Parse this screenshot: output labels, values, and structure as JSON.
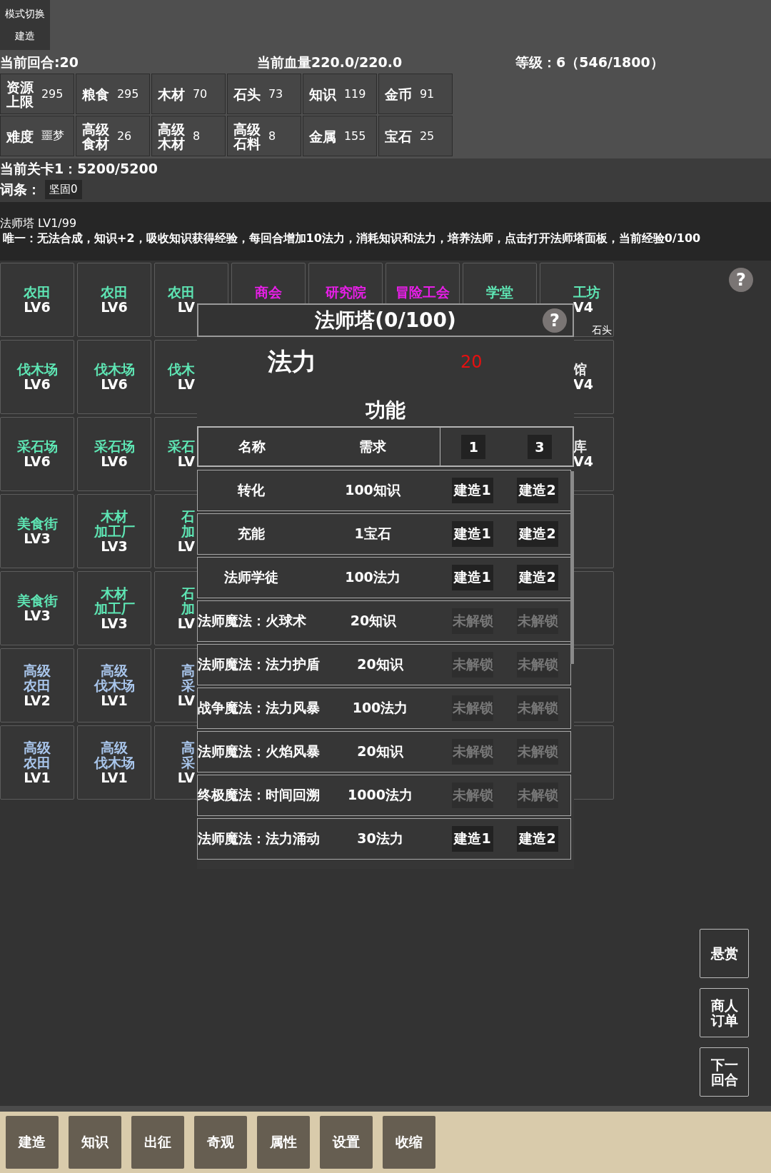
{
  "mode_switch": {
    "label": "模式切换",
    "value": "建造"
  },
  "stats": {
    "round": "当前回合:20",
    "hp": "当前血量220.0/220.0",
    "level": "等级：6（546/1800）"
  },
  "resources": [
    {
      "label": "资源上限",
      "value": "295"
    },
    {
      "label": "粮食",
      "value": "295"
    },
    {
      "label": "木材",
      "value": "70"
    },
    {
      "label": "石头",
      "value": "73"
    },
    {
      "label": "知识",
      "value": "119"
    },
    {
      "label": "金币",
      "value": "91"
    },
    {
      "label": "难度",
      "value": "噩梦"
    },
    {
      "label": "高级食材",
      "value": "26"
    },
    {
      "label": "高级木材",
      "value": "8"
    },
    {
      "label": "高级石料",
      "value": "8"
    },
    {
      "label": "金属",
      "value": "155"
    },
    {
      "label": "宝石",
      "value": "25"
    }
  ],
  "stage": {
    "progress": "当前关卡1：5200/5200",
    "affix_label": "词条：",
    "affixes": [
      "坚固0"
    ]
  },
  "selected_building": {
    "title": "法师塔 LV1/99",
    "description": "唯一：无法合成，知识+2，吸收知识获得经验，每回合增加10法力，消耗知识和法力，培养法师，点击打开法师塔面板，当前经验0/100"
  },
  "help_icon": "?",
  "grid": [
    [
      {
        "kind": "building",
        "name_lines": [
          "农田"
        ],
        "level": "LV6",
        "color": "#5ee6b4"
      },
      {
        "kind": "building",
        "name_lines": [
          "农田"
        ],
        "level": "LV6",
        "color": "#5ee6b4"
      },
      {
        "kind": "building",
        "name_lines": [
          "农田"
        ],
        "level": "LV",
        "color": "#5ee6b4"
      },
      {
        "kind": "building",
        "name_lines": [
          "商会"
        ],
        "color": "#e81ee8"
      },
      {
        "kind": "building",
        "name_lines": [
          "研究院"
        ],
        "color": "#e81ee8"
      },
      {
        "kind": "building",
        "name_lines": [
          "冒险工会"
        ],
        "color": "#e81ee8"
      },
      {
        "kind": "building",
        "name_lines": [
          "学堂"
        ],
        "color": "#5ee6b4"
      },
      {
        "kind": "building",
        "name_lines": [
          "工坊"
        ],
        "level": "V4",
        "color": "#5ee6b4",
        "badge": "石头"
      }
    ],
    [
      {
        "kind": "building",
        "name_lines": [
          "伐木场"
        ],
        "level": "LV6",
        "color": "#5ee6b4"
      },
      {
        "kind": "building",
        "name_lines": [
          "伐木场"
        ],
        "level": "LV6",
        "color": "#5ee6b4"
      },
      {
        "kind": "building",
        "name_lines": [
          "伐木"
        ],
        "level": "LV",
        "color": "#5ee6b4"
      },
      {
        "kind": "covered"
      },
      {
        "kind": "covered"
      },
      {
        "kind": "covered"
      },
      {
        "kind": "covered"
      },
      {
        "kind": "building",
        "name_lines": [
          "馆"
        ],
        "level": "V4",
        "color": "#eeeeee"
      }
    ],
    [
      {
        "kind": "building",
        "name_lines": [
          "采石场"
        ],
        "level": "LV6",
        "color": "#5ee6b4"
      },
      {
        "kind": "building",
        "name_lines": [
          "采石场"
        ],
        "level": "LV6",
        "color": "#5ee6b4"
      },
      {
        "kind": "building",
        "name_lines": [
          "采石"
        ],
        "level": "LV",
        "color": "#5ee6b4"
      },
      {
        "kind": "covered"
      },
      {
        "kind": "covered"
      },
      {
        "kind": "covered"
      },
      {
        "kind": "covered"
      },
      {
        "kind": "building",
        "name_lines": [
          "库"
        ],
        "level": "V4",
        "color": "#eeeeee"
      }
    ],
    [
      {
        "kind": "building",
        "name_lines": [
          "美食街"
        ],
        "level": "LV3",
        "color": "#5ee6b4"
      },
      {
        "kind": "building",
        "name_lines": [
          "木材",
          "加工厂"
        ],
        "level": "LV3",
        "color": "#5ee6b4"
      },
      {
        "kind": "building",
        "name_lines": [
          "石",
          "加"
        ],
        "level": "LV",
        "color": "#5ee6b4"
      },
      {
        "kind": "covered"
      },
      {
        "kind": "covered"
      },
      {
        "kind": "covered"
      },
      {
        "kind": "covered"
      },
      {
        "kind": "empty"
      }
    ],
    [
      {
        "kind": "building",
        "name_lines": [
          "美食街"
        ],
        "level": "LV3",
        "color": "#5ee6b4"
      },
      {
        "kind": "building",
        "name_lines": [
          "木材",
          "加工厂"
        ],
        "level": "LV3",
        "color": "#5ee6b4"
      },
      {
        "kind": "building",
        "name_lines": [
          "石",
          "加"
        ],
        "level": "LV",
        "color": "#5ee6b4"
      },
      {
        "kind": "covered"
      },
      {
        "kind": "covered"
      },
      {
        "kind": "covered"
      },
      {
        "kind": "covered"
      },
      {
        "kind": "empty"
      }
    ],
    [
      {
        "kind": "building",
        "name_lines": [
          "高级",
          "农田"
        ],
        "level": "LV2",
        "color": "#a9c6ec"
      },
      {
        "kind": "building",
        "name_lines": [
          "高级",
          "伐木场"
        ],
        "level": "LV1",
        "color": "#a9c6ec"
      },
      {
        "kind": "building",
        "name_lines": [
          "高",
          "采"
        ],
        "level": "LV",
        "color": "#a9c6ec"
      },
      {
        "kind": "covered"
      },
      {
        "kind": "covered"
      },
      {
        "kind": "covered"
      },
      {
        "kind": "covered"
      },
      {
        "kind": "empty"
      }
    ],
    [
      {
        "kind": "building",
        "name_lines": [
          "高级",
          "农田"
        ],
        "level": "LV1",
        "color": "#a9c6ec"
      },
      {
        "kind": "building",
        "name_lines": [
          "高级",
          "伐木场"
        ],
        "level": "LV1",
        "color": "#a9c6ec"
      },
      {
        "kind": "building",
        "name_lines": [
          "高",
          "采"
        ],
        "level": "LV",
        "color": "#a9c6ec"
      },
      {
        "kind": "covered"
      },
      {
        "kind": "covered"
      },
      {
        "kind": "covered"
      },
      {
        "kind": "covered"
      },
      {
        "kind": "empty"
      }
    ]
  ],
  "dialog": {
    "title": "法师塔(0/100)",
    "help_icon": "?",
    "resource_label": "法力",
    "resource_value": "20",
    "section_title": "功能",
    "header": {
      "name": "名称",
      "cost": "需求",
      "quantities": [
        "1",
        "3"
      ]
    },
    "rows": [
      {
        "name": "转化",
        "cost": "100知识",
        "buttons": [
          {
            "label": "建造1",
            "disabled": false
          },
          {
            "label": "建造2",
            "disabled": false
          }
        ]
      },
      {
        "name": "充能",
        "cost": "1宝石",
        "buttons": [
          {
            "label": "建造1",
            "disabled": false
          },
          {
            "label": "建造2",
            "disabled": false
          }
        ]
      },
      {
        "name": "法师学徒",
        "cost": "100法力",
        "buttons": [
          {
            "label": "建造1",
            "disabled": false
          },
          {
            "label": "建造2",
            "disabled": false
          }
        ]
      },
      {
        "name": "法师魔法：火球术",
        "cost": "20知识",
        "buttons": [
          {
            "label": "未解锁",
            "disabled": true
          },
          {
            "label": "未解锁",
            "disabled": true
          }
        ]
      },
      {
        "name": "法师魔法：法力护盾",
        "cost": "20知识",
        "buttons": [
          {
            "label": "未解锁",
            "disabled": true
          },
          {
            "label": "未解锁",
            "disabled": true
          }
        ]
      },
      {
        "name": "战争魔法：法力风暴",
        "cost": "100法力",
        "buttons": [
          {
            "label": "未解锁",
            "disabled": true
          },
          {
            "label": "未解锁",
            "disabled": true
          }
        ]
      },
      {
        "name": "法师魔法：火焰风暴",
        "cost": "20知识",
        "buttons": [
          {
            "label": "未解锁",
            "disabled": true
          },
          {
            "label": "未解锁",
            "disabled": true
          }
        ]
      },
      {
        "name": "终极魔法：时间回溯",
        "cost": "1000法力",
        "buttons": [
          {
            "label": "未解锁",
            "disabled": true
          },
          {
            "label": "未解锁",
            "disabled": true
          }
        ]
      },
      {
        "name": "法师魔法：法力涌动",
        "cost": "30法力",
        "buttons": [
          {
            "label": "建造1",
            "disabled": false
          },
          {
            "label": "建造2",
            "disabled": false
          }
        ]
      }
    ]
  },
  "side_buttons": [
    "悬赏",
    "商人订单",
    "下一回合"
  ],
  "bottom_bar": [
    "建造",
    "知识",
    "出征",
    "奇观",
    "属性",
    "设置",
    "收缩"
  ]
}
